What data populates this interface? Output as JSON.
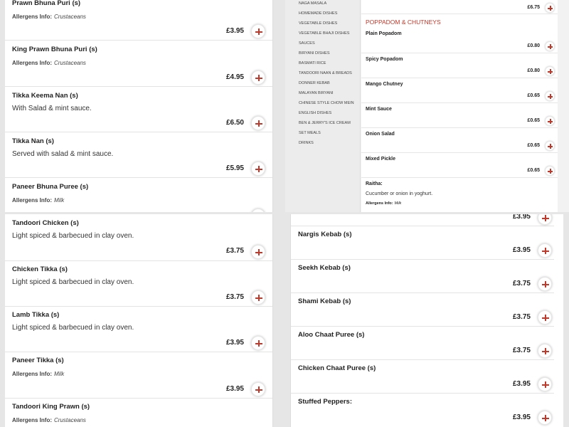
{
  "top_left": {
    "items": [
      {
        "name": "Prawn Bhuna Puri (s)",
        "allergen_label": "Allergens Info:",
        "allergen": "Crustaceans",
        "price": ""
      },
      {
        "name": "",
        "price": "£3.95"
      },
      {
        "name": "King Prawn Bhuna Puri (s)",
        "allergen_label": "Allergens Info:",
        "allergen": "Crustaceans",
        "price": "£4.95"
      },
      {
        "name": "Tikka Keema Nan (s)",
        "desc": "With Salad & mint sauce.",
        "price": "£6.50"
      },
      {
        "name": "Tikka Nan (s)",
        "desc": "Served with salad & mint sauce.",
        "price": "£5.95"
      },
      {
        "name": "Paneer Bhuna Puree (s)",
        "allergen_label": "Allergens Info:",
        "allergen": "Milk"
      }
    ]
  },
  "sidebar": {
    "categories": [
      "NAGA MASALA",
      "HOMEMADE DISHES",
      "VEGETABLE DISHES",
      "VEGETABLE BHAJI DISHES",
      "SAUCES",
      "BIRYANI DISHES",
      "BASMATI RICE",
      "TANDOORI NAAN & BREADS",
      "DONNER KEBAB",
      "MALAYAN BIRYANI",
      "CHINESE STYLE CHOW MEIN",
      "ENGLISH DISHES",
      "BEN & JERRY'S ICE CREAM",
      "SET MEALS",
      "DRINKS"
    ]
  },
  "small_menu": {
    "top_price": "£6.75",
    "section_title": "POPPADOM & CHUTNEYS",
    "items": [
      {
        "name": "Plain Popadom",
        "price": "£0.80"
      },
      {
        "name": "Spicy Popadom",
        "price": "£0.80"
      },
      {
        "name": "Mango Chutney",
        "price": "£0.65"
      },
      {
        "name": "Mint Sauce",
        "price": "£0.65"
      },
      {
        "name": "Onion Salad",
        "price": "£0.65"
      },
      {
        "name": "Mixed Pickle",
        "price": "£0.65"
      }
    ],
    "raitha": {
      "name": "Raitha:",
      "desc": "Cucumber or onion in yoghurt.",
      "allergen_label": "Allergens Info:",
      "allergen": "Milk"
    }
  },
  "bottom_left": {
    "items": [
      {
        "name": "Tandoori Chicken (s)",
        "desc": "Light spiced & barbecued in clay oven.",
        "price": "£3.75"
      },
      {
        "name": "Chicken Tikka (s)",
        "desc": "Light spiced & barbecued in clay oven.",
        "price": "£3.75"
      },
      {
        "name": "Lamb Tikka (s)",
        "desc": "Light spiced & barbecued in clay oven.",
        "price": "£3.95"
      },
      {
        "name": "Paneer Tikka (s)",
        "allergen_label": "Allergens Info:",
        "allergen": "Milk",
        "price": "£3.95"
      },
      {
        "name": "Tandoori King Prawn (s)",
        "allergen_label": "Allergens Info:",
        "allergen": "Crustaceans"
      }
    ]
  },
  "bottom_right": {
    "first_price": "£3.95",
    "items": [
      {
        "name": "Nargis Kebab (s)",
        "price": "£3.95"
      },
      {
        "name": "Seekh Kebab (s)",
        "price": "£3.75"
      },
      {
        "name": "Shami Kebab (s)",
        "price": "£3.75"
      },
      {
        "name": "Aloo Chaat Puree (s)",
        "price": "£3.75"
      },
      {
        "name": "Chicken Chaat Puree (s)",
        "price": "£3.95"
      },
      {
        "name": "Stuffed Peppers:",
        "price": "£3.95"
      }
    ]
  }
}
